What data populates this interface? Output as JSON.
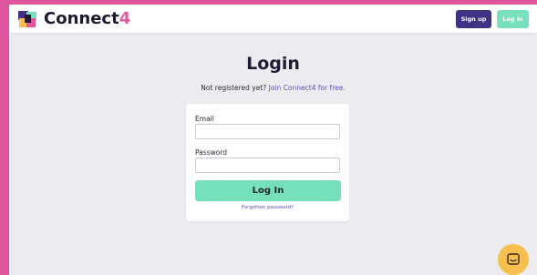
{
  "app": {
    "brand_name": "Connect",
    "brand_suffix": "4"
  },
  "header": {
    "signup_label": "Sign up",
    "login_label": "Log in"
  },
  "main": {
    "title": "Login",
    "subtitle_text": "Not registered yet?",
    "subtitle_link": "Join Connect4 for free."
  },
  "form": {
    "email_label": "Email",
    "email_value": "",
    "password_label": "Password",
    "password_value": "",
    "submit_label": "Log In",
    "forgot_label": "Forgotten password?"
  },
  "chat": {
    "icon": "chat-widget-icon"
  },
  "colors": {
    "background_border": "#e0559e",
    "page_bg": "#ecebef",
    "signup_button": "#3e3383",
    "accent_green": "#76dfbb",
    "link": "#5b4fb0",
    "brand_pink": "#e5559c",
    "chat_button": "#f6bf4e"
  }
}
